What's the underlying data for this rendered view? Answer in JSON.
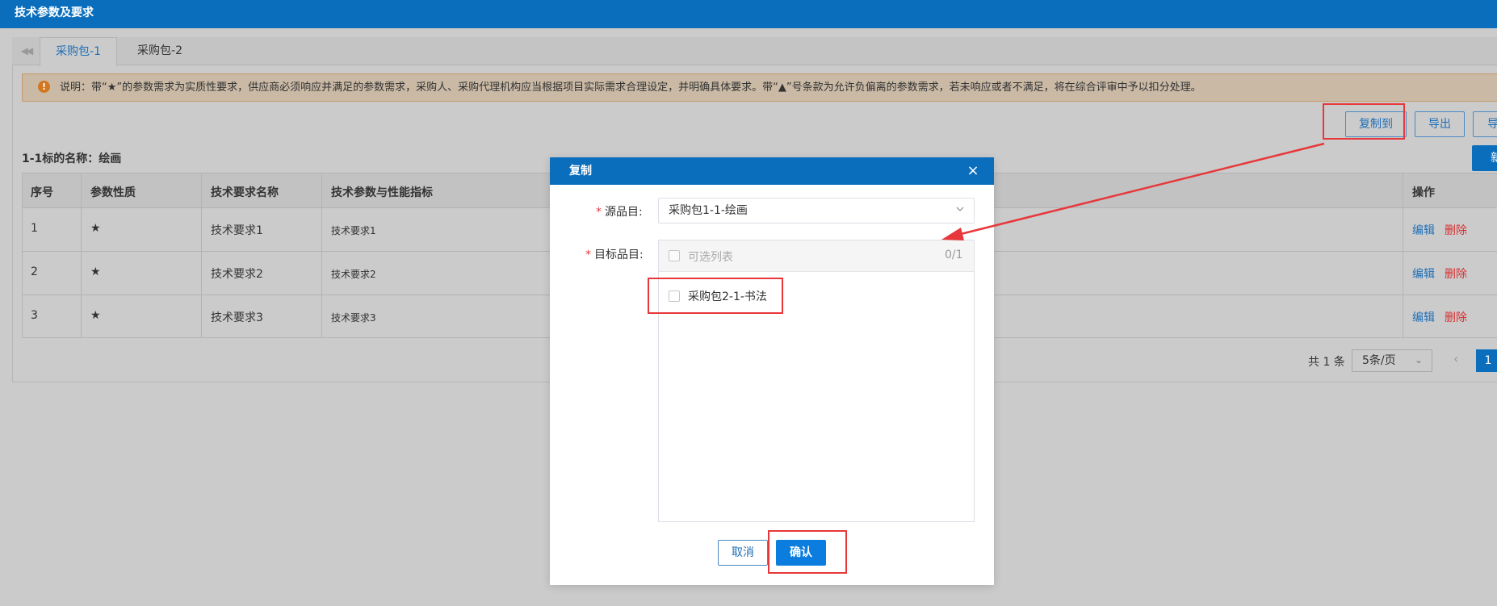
{
  "header": {
    "title": "技术参数及要求"
  },
  "tabs": [
    {
      "label": "采购包-1",
      "active": true
    },
    {
      "label": "采购包-2",
      "active": false
    }
  ],
  "notice": {
    "icon": "exclamation-icon",
    "text": "说明：带“★”的参数需求为实质性要求，供应商必须响应并满足的参数需求，采购人、采购代理机构应当根据项目实际需求合理设定，并明确具体要求。带“▲”号条款为允许负偏离的参数需求，若未响应或者不满足，将在综合评审中予以扣分处理。"
  },
  "toolbar": {
    "copy_to": "复制到",
    "export": "导出",
    "import": "导",
    "new": "新"
  },
  "section": {
    "title": "1-1标的名称：绘画"
  },
  "table": {
    "headers": [
      "序号",
      "参数性质",
      "技术要求名称",
      "技术参数与性能指标",
      "操作"
    ],
    "rows": [
      {
        "no": "1",
        "nature": "★",
        "name": "技术要求1",
        "spec": "技术要求1",
        "edit": "编辑",
        "delete": "删除"
      },
      {
        "no": "2",
        "nature": "★",
        "name": "技术要求2",
        "spec": "技术要求2",
        "edit": "编辑",
        "delete": "删除"
      },
      {
        "no": "3",
        "nature": "★",
        "name": "技术要求3",
        "spec": "技术要求3",
        "edit": "编辑",
        "delete": "删除"
      }
    ]
  },
  "pager": {
    "total": "共 1 条",
    "page_size": "5条/页",
    "current_page": "1",
    "prev": "‹"
  },
  "modal": {
    "title": "复制",
    "close": "×",
    "source_label": "源品目:",
    "source_value": "采购包1-1-绘画",
    "target_label": "目标品目:",
    "list_title": "可选列表",
    "list_count": "0/1",
    "items": [
      "采购包2-1-书法"
    ],
    "cancel": "取消",
    "confirm": "确认"
  },
  "colors": {
    "primary": "#0a6ebd",
    "annotation": "#e8373a"
  }
}
